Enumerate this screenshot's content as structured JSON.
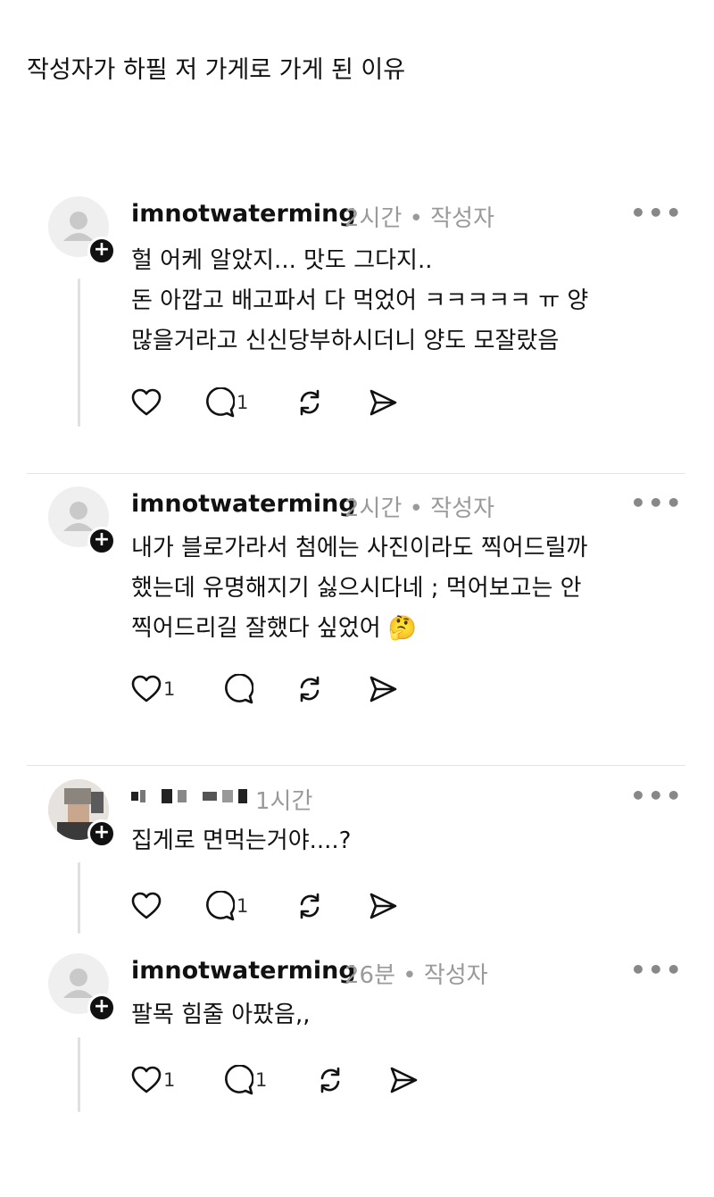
{
  "title": "작성자가 하필 저 가게로 가게 된 이유",
  "comments": [
    {
      "username": "imnotwaterming",
      "meta": "2시간 • 작성자",
      "body": "헐 어케 알았지... 맛도 그다지..\n돈 아깝고 배고파서 다 먹었어 ㅋㅋㅋㅋㅋ ㅠ 양\n많을거라고 신신당부하시더니 양도 모잘랐음",
      "like_count": "",
      "reply_count": "1"
    },
    {
      "username": "imnotwaterming",
      "meta": "2시간 • 작성자",
      "body": "내가 블로가라서 첨에는 사진이라도 찍어드릴까\n했는데 유명해지기 싫으시다네 ; 먹어보고는 안\n찍어드리길 잘했다 싶었어 🤔",
      "like_count": "1",
      "reply_count": ""
    },
    {
      "username": "",
      "meta": "1시간",
      "body": "집게로 면먹는거야....?",
      "like_count": "",
      "reply_count": "1"
    },
    {
      "username": "imnotwaterming",
      "meta": "26분 • 작성자",
      "body": "팔목 힘줄 아팠음,,",
      "like_count": "1",
      "reply_count": "1"
    }
  ],
  "more_label": "•••",
  "plus_label": "+",
  "icons": [
    "heart-icon",
    "comment-icon",
    "repost-icon",
    "send-icon",
    "person-icon",
    "plus-icon",
    "more-icon"
  ]
}
